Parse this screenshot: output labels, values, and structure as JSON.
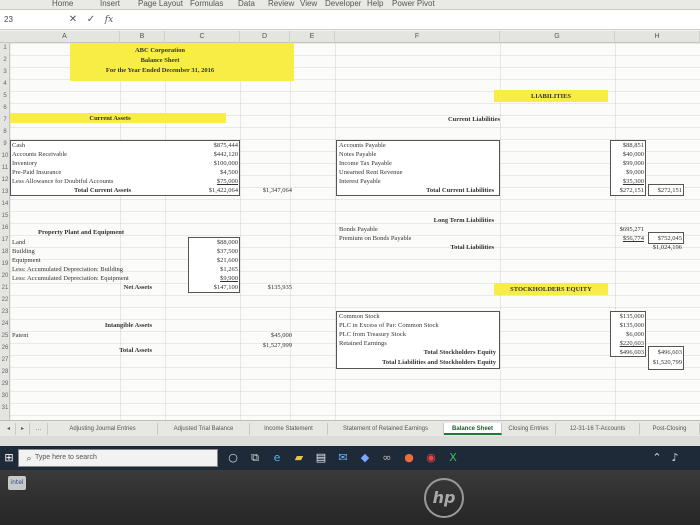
{
  "ribbon": {
    "tabs": [
      "Home",
      "Insert",
      "Page Layout",
      "Formulas",
      "Data",
      "Review",
      "View",
      "Developer",
      "Help",
      "Power Pivot"
    ]
  },
  "formula_bar": {
    "name_box": "23",
    "cancel": "✕",
    "enter": "✓",
    "fx": "fx"
  },
  "columns": [
    "A",
    "B",
    "C",
    "D",
    "E",
    "F",
    "G",
    "H"
  ],
  "rows": [
    "1",
    "2",
    "3",
    "4",
    "5",
    "6",
    "7",
    "8",
    "9",
    "10",
    "11",
    "12",
    "13",
    "14",
    "15",
    "16",
    "17",
    "18",
    "19",
    "20",
    "21",
    "22",
    "23",
    "24",
    "25",
    "26",
    "27",
    "28",
    "29",
    "30",
    "31"
  ],
  "header": {
    "company": "ABC Corporation",
    "statement": "Balance Sheet",
    "period": "For the Year Ended December 31, 2016"
  },
  "sections": {
    "liabilities": "LIABILITIES",
    "current_assets": "Current Assets",
    "current_liabilities": "Current Liabilities",
    "property": "Property Plant and Equipment",
    "long_term": "Long Term Liabilities",
    "equity": "STOCKHOLDERS EQUITY",
    "intangible": "Intangible Assets"
  },
  "current_assets": {
    "labels": [
      "Cash",
      "Accounts Receivable",
      "Inventory",
      "Pre-Paid Insurance",
      "Less Allowance for Doubtful Accounts"
    ],
    "values": [
      "$875,444",
      "$442,120",
      "$100,000",
      "$4,500",
      "$75,000"
    ],
    "total_label": "Total Current Assets",
    "total": "$1,422,064",
    "net": "$1,347,064"
  },
  "current_liabilities": {
    "labels": [
      "Accounts Payable",
      "Notes Payable",
      "Income Tax Payable",
      "Unearned Rent Revenue",
      "Interest Payable"
    ],
    "values": [
      "$88,851",
      "$40,000",
      "$99,000",
      "$9,000",
      "$35,300"
    ],
    "total_label": "Total Current Liabilities",
    "total": "$272,151",
    "total2": "$272,151"
  },
  "long_term_liabilities": {
    "labels": [
      "Bonds Payable",
      "Premium on Bonds Payable"
    ],
    "values": [
      "$695,271",
      "$56,774"
    ],
    "subtotal": "$752,045",
    "total_label": "Total Liabilities",
    "total": "$1,024,196"
  },
  "property": {
    "labels": [
      "Land",
      "Building",
      "Equipment",
      "Less: Accumulated Depreciation: Building",
      "Less: Accumulated Depreciation: Equipment"
    ],
    "values": [
      "$88,000",
      "$37,500",
      "$21,600",
      "$1,265",
      "$9,900"
    ],
    "net_label": "Net Assets",
    "net": "$147,100",
    "net2": "$135,935"
  },
  "intangible": {
    "labels": [
      "Patent"
    ],
    "values": [
      "$45,000"
    ],
    "total_label": "Total Assets",
    "total": "$1,527,999"
  },
  "equity": {
    "labels": [
      "Common Stock",
      "PLC in Excess of Par: Common Stock",
      "PLC from Treasury Stock",
      "Retained Earnings"
    ],
    "values": [
      "$135,000",
      "$135,000",
      "$6,000",
      "$220,603"
    ],
    "total_label": "Total Stockholders Equity",
    "total": "$496,603",
    "total2": "$496,603",
    "grand_label": "Total Liabilities and Stockholders Equity",
    "grand": "$1,520,799"
  },
  "sheet_tabs": [
    "Adjusting Journal Entries",
    "Adjusted Trial Balance",
    "Income Statement",
    "Statement of Retained Earnings",
    "Balance Sheet",
    "Closing Entries",
    "12-31-16 T-Accounts",
    "Post-Closing"
  ],
  "taskbar": {
    "search_placeholder": "Type here to search"
  },
  "bezel": {
    "logo": "hp",
    "sticker": "intel"
  },
  "colors": {
    "highlight": "#f7ed45",
    "active_tab": "#1d7a3a"
  }
}
